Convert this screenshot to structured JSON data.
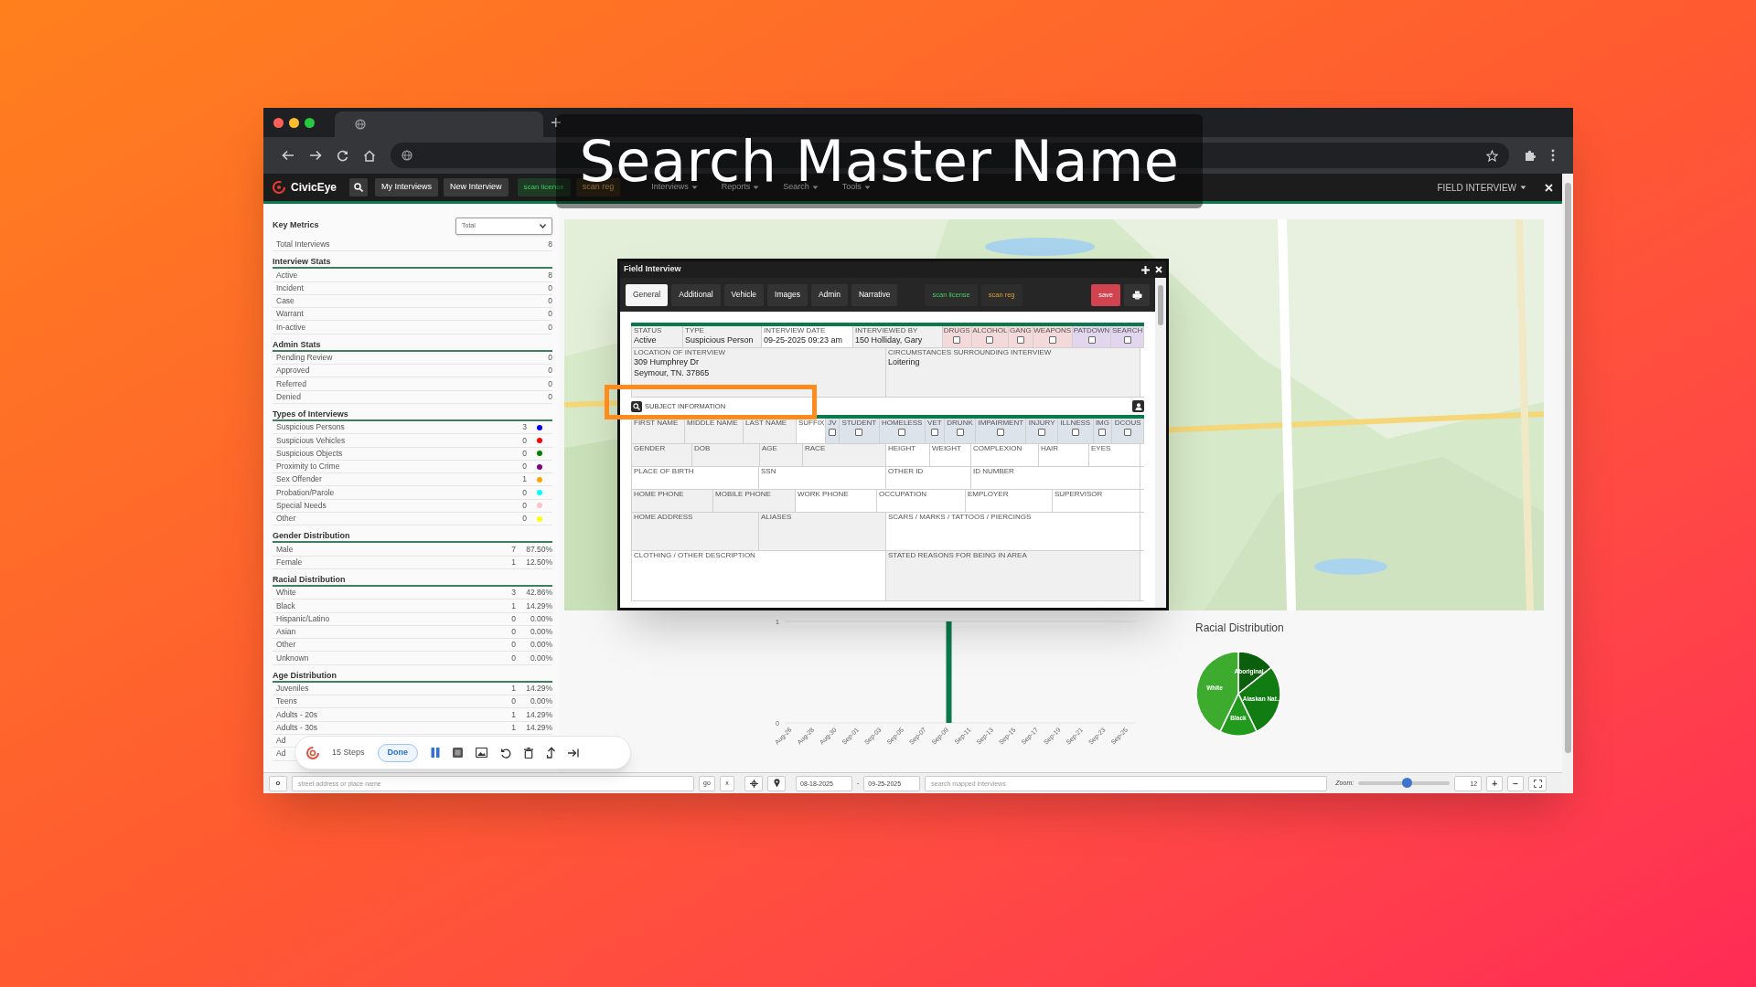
{
  "title_overlay": "Search Master Name",
  "nav": {
    "brand": "CivicEye",
    "items": [
      {
        "label": "My Interviews",
        "kind": "button"
      },
      {
        "label": "New Interview",
        "kind": "button"
      },
      {
        "label": "scan license",
        "kind": "scan-license"
      },
      {
        "label": "scan reg",
        "kind": "scan-reg"
      },
      {
        "label": "Interviews",
        "kind": "menu"
      },
      {
        "label": "Reports",
        "kind": "menu"
      },
      {
        "label": "Search",
        "kind": "menu"
      },
      {
        "label": "Tools",
        "kind": "menu"
      }
    ],
    "right_menu": "FIELD INTERVIEW"
  },
  "key_metrics": {
    "title": "Key Metrics",
    "select": "Total",
    "rows": [
      {
        "label": "Total Interviews",
        "count": "8"
      }
    ]
  },
  "sections": [
    {
      "title": "Interview Stats",
      "rows": [
        {
          "label": "Active",
          "count": "8"
        },
        {
          "label": "Incident",
          "count": "0"
        },
        {
          "label": "Case",
          "count": "0"
        },
        {
          "label": "Warrant",
          "count": "0"
        },
        {
          "label": "In-active",
          "count": "0"
        }
      ]
    },
    {
      "title": "Admin Stats",
      "rows": [
        {
          "label": "Pending Review",
          "count": "0"
        },
        {
          "label": "Approved",
          "count": "0"
        },
        {
          "label": "Referred",
          "count": "0"
        },
        {
          "label": "Denied",
          "count": "0"
        }
      ]
    },
    {
      "title": "Types of Interviews",
      "rows": [
        {
          "label": "Suspicious Persons",
          "count": "3",
          "color": "#0000ff"
        },
        {
          "label": "Suspicious Vehicles",
          "count": "0",
          "color": "#ff0000"
        },
        {
          "label": "Suspicious Objects",
          "count": "0",
          "color": "#008000"
        },
        {
          "label": "Proximity to Crime",
          "count": "0",
          "color": "#800080"
        },
        {
          "label": "Sex Offender",
          "count": "1",
          "color": "#ffa500"
        },
        {
          "label": "Probation/Parole",
          "count": "0",
          "color": "#00ffff"
        },
        {
          "label": "Special Needs",
          "count": "0",
          "color": "#ffc0cb"
        },
        {
          "label": "Other",
          "count": "0",
          "color": "#ffff00"
        }
      ]
    },
    {
      "title": "Gender Distribution",
      "rows": [
        {
          "label": "Male",
          "count": "7",
          "pct": "87.50%"
        },
        {
          "label": "Female",
          "count": "1",
          "pct": "12.50%"
        }
      ]
    },
    {
      "title": "Racial Distribution",
      "rows": [
        {
          "label": "White",
          "count": "3",
          "pct": "42.86%"
        },
        {
          "label": "Black",
          "count": "1",
          "pct": "14.29%"
        },
        {
          "label": "Hispanic/Latino",
          "count": "0",
          "pct": "0.00%"
        },
        {
          "label": "Asian",
          "count": "0",
          "pct": "0.00%"
        },
        {
          "label": "Other",
          "count": "0",
          "pct": "0.00%"
        },
        {
          "label": "Unknown",
          "count": "0",
          "pct": "0.00%"
        }
      ]
    },
    {
      "title": "Age Distribution",
      "rows": [
        {
          "label": "Juveniles",
          "count": "1",
          "pct": "14.29%"
        },
        {
          "label": "Teens",
          "count": "0",
          "pct": "0.00%"
        },
        {
          "label": "Adults - 20s",
          "count": "1",
          "pct": "14.29%"
        },
        {
          "label": "Adults - 30s",
          "count": "1",
          "pct": "14.29%"
        },
        {
          "label": "Ad"
        },
        {
          "label": "Ad"
        }
      ]
    }
  ],
  "dialog": {
    "title": "Field Interview",
    "tabs": [
      {
        "label": "General",
        "selected": true
      },
      {
        "label": "Additional",
        "selected": false
      },
      {
        "label": "Vehicle",
        "selected": false
      },
      {
        "label": "Images",
        "selected": false
      },
      {
        "label": "Admin",
        "selected": false
      },
      {
        "label": "Narrative",
        "selected": false
      }
    ],
    "actions": [
      {
        "label": "scan license",
        "kind": "scan-license"
      },
      {
        "label": "scan reg",
        "kind": "scan-reg"
      },
      {
        "label": "save",
        "kind": "save"
      }
    ],
    "incident_rows": [
      [
        {
          "kind": "field",
          "label": "STATUS",
          "value": "Active",
          "shaded": true
        },
        {
          "kind": "field",
          "label": "TYPE",
          "value": "Suspicious Person",
          "shaded": true
        },
        {
          "kind": "field",
          "label": "INTERVIEW DATE",
          "value": "09-25-2025 09:23 am",
          "shaded": false
        },
        {
          "kind": "field",
          "label": "INTERVIEWED BY",
          "value": "150 Holliday, Gary",
          "shaded": true
        },
        {
          "kind": "checkbox",
          "label": "DRUGS",
          "checked": false,
          "color": "#f3d9d9"
        },
        {
          "kind": "checkbox",
          "label": "ALCOHOL",
          "checked": false,
          "color": "#f3d9d9"
        },
        {
          "kind": "checkbox",
          "label": "GANG",
          "checked": false,
          "color": "#f3d9d9"
        },
        {
          "kind": "checkbox",
          "label": "WEAPONS",
          "checked": false,
          "color": "#f3d9d9"
        },
        {
          "kind": "checkbox",
          "label": "PATDOWN",
          "checked": false,
          "color": "#e1d6ee"
        },
        {
          "kind": "checkbox",
          "label": "SEARCH",
          "checked": false,
          "color": "#e1d6ee"
        }
      ],
      [
        {
          "kind": "field",
          "label": "LOCATION OF INTERVIEW",
          "value": "309 Humphrey Dr\nSeymour, TN. 37865",
          "shaded": true
        },
        {
          "kind": "field",
          "label": "CIRCUMSTANCES SURROUNDING INTERVIEW",
          "value": "Loitering",
          "shaded": true
        }
      ]
    ],
    "subject_header": "SUBJECT INFORMATION",
    "subject_rows": [
      [
        {
          "kind": "field",
          "label": "FIRST NAME",
          "shaded": true
        },
        {
          "kind": "field",
          "label": "MIDDLE NAME",
          "shaded": true
        },
        {
          "kind": "field",
          "label": "LAST NAME",
          "shaded": true
        },
        {
          "kind": "field",
          "label": "SUFFIX",
          "shaded": false
        },
        {
          "kind": "checkbox",
          "label": "JV",
          "checked": false,
          "color": "#dde3ea"
        },
        {
          "kind": "checkbox",
          "label": "STUDENT",
          "checked": false,
          "color": "#dde3ea"
        },
        {
          "kind": "checkbox",
          "label": "HOMELESS",
          "checked": false,
          "color": "#dde3ea"
        },
        {
          "kind": "checkbox",
          "label": "VET",
          "checked": false,
          "color": "#dde3ea"
        },
        {
          "kind": "checkbox",
          "label": "DRUNK",
          "checked": false,
          "color": "#dde3ea"
        },
        {
          "kind": "checkbox",
          "label": "IMPAIRMENT",
          "checked": false,
          "color": "#dde3ea"
        },
        {
          "kind": "checkbox",
          "label": "INJURY",
          "checked": false,
          "color": "#dde3ea"
        },
        {
          "kind": "checkbox",
          "label": "ILLNESS",
          "checked": false,
          "color": "#dde3ea"
        },
        {
          "kind": "checkbox",
          "label": "IMG",
          "checked": false,
          "color": "#dde3ea"
        },
        {
          "kind": "checkbox",
          "label": "DCOUS",
          "checked": false,
          "color": "#dde3ea"
        }
      ],
      [
        {
          "kind": "field",
          "label": "GENDER",
          "shaded": true
        },
        {
          "kind": "field",
          "label": "DOB",
          "shaded": true
        },
        {
          "kind": "field",
          "label": "AGE",
          "shaded": true
        },
        {
          "kind": "field",
          "label": "RACE",
          "shaded": true
        },
        {
          "kind": "field",
          "label": "HEIGHT",
          "shaded": false
        },
        {
          "kind": "field",
          "label": "WEIGHT",
          "shaded": false
        },
        {
          "kind": "field",
          "label": "COMPLEXION",
          "shaded": false
        },
        {
          "kind": "field",
          "label": "HAIR",
          "shaded": false
        },
        {
          "kind": "field",
          "label": "EYES",
          "shaded": false
        }
      ],
      [
        {
          "kind": "field",
          "label": "PLACE OF BIRTH",
          "shaded": false
        },
        {
          "kind": "field",
          "label": "SSN",
          "shaded": false
        },
        {
          "kind": "field",
          "label": "OTHER ID",
          "shaded": false
        },
        {
          "kind": "field",
          "label": "ID NUMBER",
          "shaded": false
        }
      ],
      [
        {
          "kind": "field",
          "label": "HOME PHONE",
          "shaded": true
        },
        {
          "kind": "field",
          "label": "MOBILE PHONE",
          "shaded": true
        },
        {
          "kind": "field",
          "label": "WORK PHONE",
          "shaded": false
        },
        {
          "kind": "field",
          "label": "OCCUPATION",
          "shaded": false
        },
        {
          "kind": "field",
          "label": "EMPLOYER",
          "shaded": false
        },
        {
          "kind": "field",
          "label": "SUPERVISOR",
          "shaded": false
        }
      ],
      [
        {
          "kind": "field",
          "label": "HOME ADDRESS",
          "shaded": true
        },
        {
          "kind": "field",
          "label": "ALIASES",
          "shaded": true
        },
        {
          "kind": "field",
          "label": "SCARS / MARKS / TATTOOS / PIERCINGS",
          "shaded": false
        }
      ],
      [
        {
          "kind": "field",
          "label": "CLOTHING / OTHER DESCRIPTION",
          "shaded": false
        },
        {
          "kind": "field",
          "label": "STATED REASONS FOR BEING IN AREA",
          "shaded": true
        }
      ]
    ]
  },
  "interviews_chart": {
    "chart_data": {
      "type": "bar",
      "categories": [
        "Aug-26",
        "Aug-28",
        "Aug-30",
        "Sep-01",
        "Sep-03",
        "Sep-05",
        "Sep-07",
        "Sep-09",
        "Sep-11",
        "Sep-13",
        "Sep-15",
        "Sep-17",
        "Sep-19",
        "Sep-21",
        "Sep-23",
        "Sep-25"
      ],
      "series": [
        {
          "color": "#0b7a4b",
          "values": [
            0,
            0,
            0,
            0,
            0,
            0,
            0,
            1,
            0,
            0,
            0,
            0,
            0,
            0,
            0,
            0
          ]
        }
      ],
      "yticks": [
        0,
        1
      ],
      "ylim": [
        0,
        1
      ]
    }
  },
  "racial_chart": {
    "chart_data": {
      "type": "pie",
      "title": "Racial Distribution",
      "categories": [
        "Aboriginal",
        "Alaskan Nat...",
        "Black",
        "White"
      ],
      "series": [
        {
          "values": [
            14.28,
            28.57,
            14.29,
            42.86
          ],
          "colors": [
            "#0b5e0b",
            "#117c11",
            "#229a1e",
            "#3dac2e"
          ]
        }
      ]
    }
  },
  "recorder": {
    "steps": "15 Steps",
    "done": "Done"
  },
  "bottom_bar": {
    "toggle": "o",
    "street_placeholder": "street address or place name",
    "go": "go",
    "clear": "x",
    "date_from": "08-18-2025",
    "date_sep": "-",
    "date_to": "09-25-2025",
    "search_placeholder": "search mapped interviews",
    "zoom_label": "Zoom:",
    "zoom": {
      "level": 0.53
    },
    "zoom_value": "12",
    "zoom_in": "+",
    "zoom_out": "−"
  }
}
